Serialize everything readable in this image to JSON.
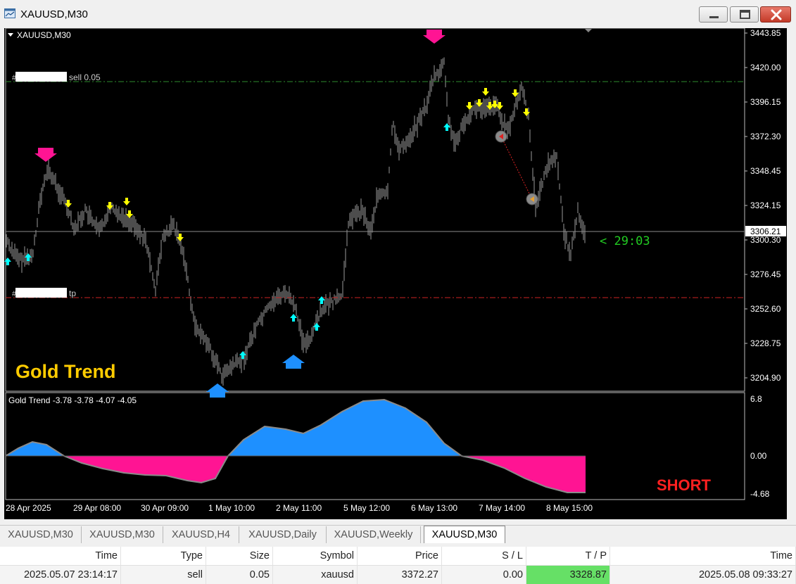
{
  "window": {
    "title": "XAUUSD,M30"
  },
  "chart": {
    "label": "XAUUSD,M30",
    "indicator_watermark": "Gold Trend",
    "signal_text": "SHORT",
    "countdown": "< 29:03",
    "order_lines": {
      "sell_label": "sell 0.05",
      "tp_label": "tp"
    },
    "current_price": "3306.21",
    "price_ticks": [
      "3443.85",
      "3420.00",
      "3396.15",
      "3372.30",
      "3348.45",
      "3324.15",
      "3300.30",
      "3276.45",
      "3252.60",
      "3228.75",
      "3204.90"
    ],
    "time_ticks": [
      "28 Apr 2025",
      "29 Apr 08:00",
      "30 Apr 09:00",
      "1 May 10:00",
      "2 May 11:00",
      "5 May 12:00",
      "6 May 13:00",
      "7 May 14:00",
      "8 May 15:00"
    ],
    "indicator": {
      "header": "Gold Trend  -3.78 -3.78 -4.07 -4.05",
      "ticks": [
        "6.8",
        "0.00",
        "-4.68"
      ]
    },
    "colors": {
      "bull": "#1e90ff",
      "bear": "#ff1493",
      "buy_arrow": "#00ffff",
      "sell_arrow": "#ffff00",
      "sell_line": "#2e8b2e",
      "tp_line": "#cc2222",
      "countdown": "#22cc22",
      "short": "#ff2020",
      "watermark": "#ffcc00"
    }
  },
  "tabs": [
    {
      "label": "XAUUSD,M30",
      "active": false
    },
    {
      "label": "XAUUSD,M30",
      "active": false
    },
    {
      "label": "XAUUSD,H4",
      "active": false
    },
    {
      "label": "XAUUSD,Daily",
      "active": false
    },
    {
      "label": "XAUUSD,Weekly",
      "active": false
    },
    {
      "label": "XAUUSD,M30",
      "active": true
    }
  ],
  "trades": {
    "columns": [
      "Time",
      "Type",
      "Size",
      "Symbol",
      "Price",
      "S / L",
      "T / P",
      "Time"
    ],
    "rows": [
      [
        "2025.05.07 23:14:17",
        "sell",
        "0.05",
        "xauusd",
        "3372.27",
        "0.00",
        "3328.87",
        "2025.05.08 09:33:27"
      ]
    ]
  }
}
